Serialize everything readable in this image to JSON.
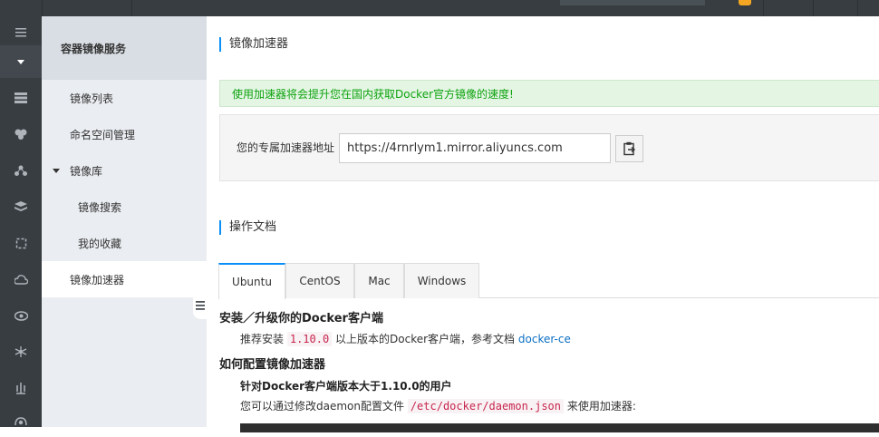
{
  "topbar": {},
  "iconbar": {
    "icons": [
      "menu-icon",
      "dropdown-icon",
      "server-icon",
      "cluster-icon",
      "network-icon",
      "layers-icon",
      "container-icon",
      "cloud-icon",
      "eye-icon",
      "graph-icon",
      "balance-icon",
      "image-service-icon"
    ]
  },
  "sidenav": {
    "title": "容器镜像服务",
    "items": [
      {
        "label": "镜像列表"
      },
      {
        "label": "命名空间管理"
      },
      {
        "label": "镜像库"
      },
      {
        "label": "镜像搜索"
      },
      {
        "label": "我的收藏"
      },
      {
        "label": "镜像加速器"
      }
    ]
  },
  "main": {
    "section1_title": "镜像加速器",
    "alert": "使用加速器将会提升您在国内获取Docker官方镜像的速度!",
    "accel_label": "您的专属加速器地址",
    "accel_url": "https://4rnrlym1.mirror.aliyuncs.com",
    "section2_title": "操作文档",
    "tabs": [
      {
        "label": "Ubuntu"
      },
      {
        "label": "CentOS"
      },
      {
        "label": "Mac"
      },
      {
        "label": "Windows"
      }
    ],
    "doc": {
      "h1": "安装／升级你的Docker客户端",
      "p1_pre": "推荐安装",
      "p1_code": "1.10.0",
      "p1_mid": "以上版本的Docker客户端，参考文档",
      "p1_link": "docker-ce",
      "h2": "如何配置镜像加速器",
      "sub": "针对Docker客户端版本大于1.10.0的用户",
      "p2_pre": "您可以通过修改daemon配置文件",
      "p2_code": "/etc/docker/daemon.json",
      "p2_post": "来使用加速器:"
    }
  },
  "colors": {
    "accent": "#0b8ef5",
    "alert_text": "#0fa30f",
    "sidebar_dark": "#373d41"
  }
}
